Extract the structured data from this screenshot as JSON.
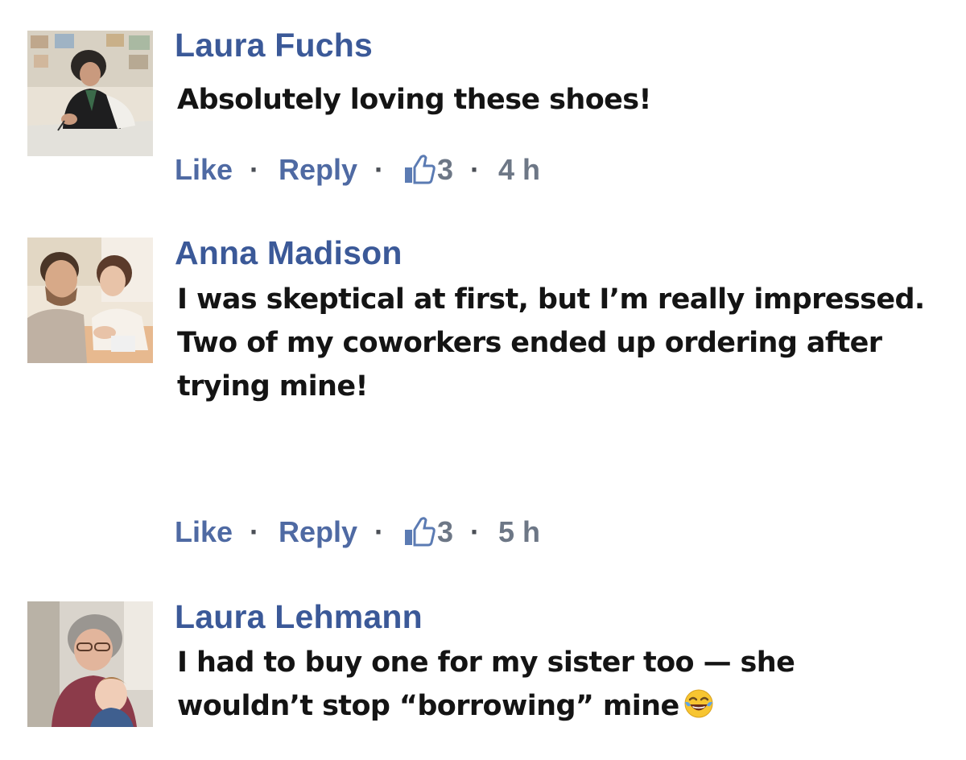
{
  "comments": [
    {
      "author": "Laura Fuchs",
      "lines": [
        "Absolutely loving these shoes!"
      ],
      "actions": {
        "like_label": "Like",
        "reply_label": "Reply",
        "likes": "3",
        "time": "4 h"
      },
      "avatar_icon": "woman-at-desk-photo"
    },
    {
      "author": "Anna Madison",
      "lines": [
        "I was skeptical at first, but I’m really impressed.",
        "Two of my coworkers ended up ordering after",
        "trying mine!"
      ],
      "actions": {
        "like_label": "Like",
        "reply_label": "Reply",
        "likes": "3",
        "time": "5 h"
      },
      "avatar_icon": "couple-selfie-photo"
    },
    {
      "author": "Laura Lehmann",
      "lines": [
        "I had to buy one for my sister too — she",
        "wouldn’t stop “borrowing” mine"
      ],
      "emoji": "tears-of-joy-emoji",
      "avatar_icon": "grandmother-child-photo"
    }
  ],
  "separator": "·",
  "colors": {
    "author": "#3b5998",
    "action_link": "#4f6aa3",
    "muted": "#6d7786",
    "body_text": "#141414"
  }
}
